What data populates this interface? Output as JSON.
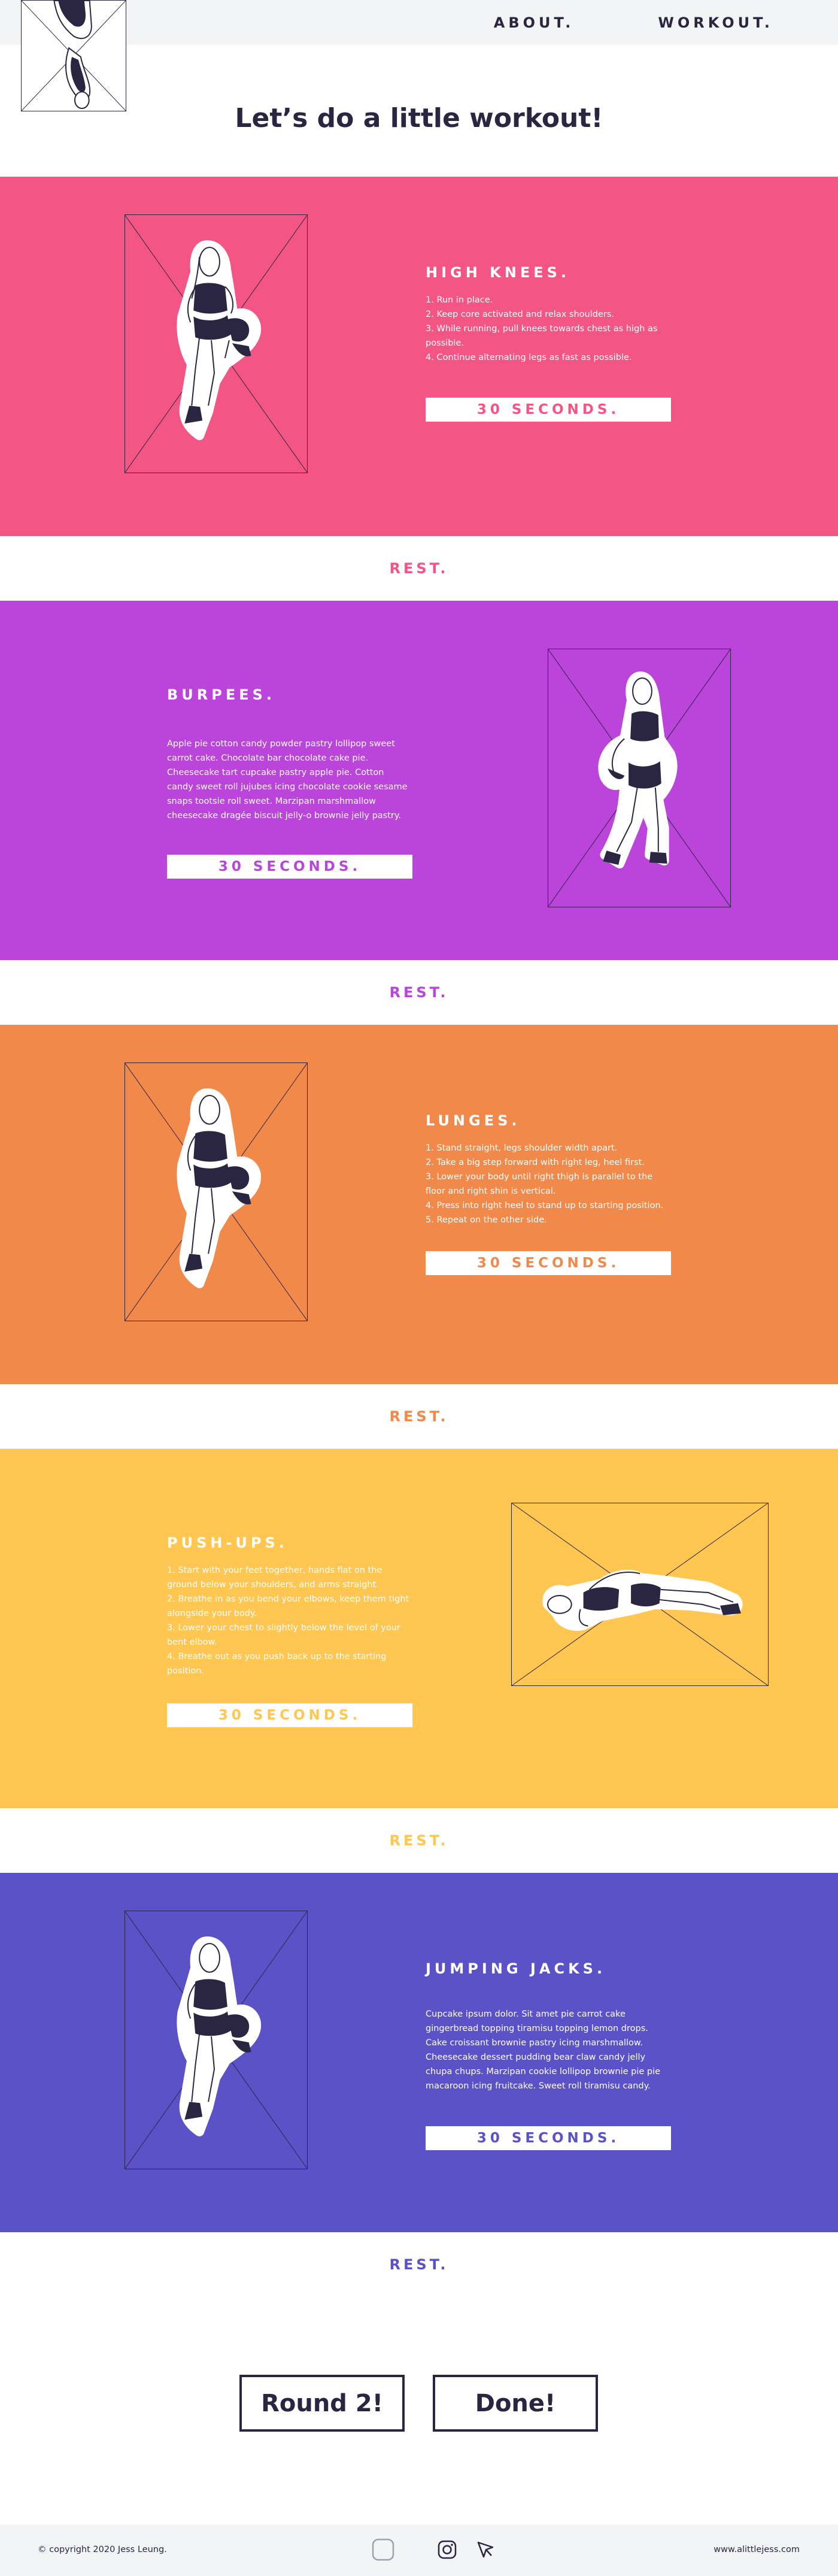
{
  "header": {
    "nav": [
      "ABOUT.",
      "WORKOUT."
    ]
  },
  "hero": {
    "title": "Let’s do a little workout!"
  },
  "exercises": [
    {
      "title": "HIGH KNEES.",
      "steps": [
        "1. Run in place.",
        "2. Keep core activated and relax shoulders.",
        "3. While running, pull knees towards chest as high as possible.",
        "4. Continue alternating legs as fast as possible."
      ],
      "duration": "30 SECONDS.",
      "accent": "#f35584"
    },
    {
      "title": "BURPEES.",
      "description": "Apple pie cotton candy powder pastry lollipop sweet carrot cake. Chocolate bar chocolate cake pie. Cheesecake tart cupcake pastry apple pie. Cotton candy sweet roll jujubes icing chocolate cookie sesame snaps tootsie roll sweet. Marzipan marshmallow cheesecake dragée biscuit jelly-o brownie jelly pastry.",
      "duration": "30 SECONDS.",
      "accent": "#bb44db"
    },
    {
      "title": "LUNGES.",
      "steps": [
        "1. Stand straight, legs shoulder width apart.",
        "2. Take a big step forward with right leg, heel first.",
        "3. Lower your body until right thigh is parallel to the floor and right shin is vertical.",
        "4. Press into right heel to stand up to starting position.",
        "5. Repeat on the other side."
      ],
      "duration": "30 SECONDS.",
      "accent": "#f1894a"
    },
    {
      "title": "PUSH-UPS.",
      "steps": [
        "1. Start with your feet together, hands flat on the ground below your shoulders, and arms straight.",
        "2. Breathe in as you bend your elbows, keep them tight alongside your body.",
        "3. Lower your chest to slightly below the level of your bent elbow.",
        "4. Breathe out as you push back up to the starting position."
      ],
      "duration": "30 SECONDS.",
      "accent": "#ffc651"
    },
    {
      "title": "JUMPING JACKS.",
      "description": "Cupcake ipsum dolor. Sit amet pie carrot cake gingerbread topping tiramisu topping lemon drops. Cake croissant brownie pastry icing marshmallow. Cheesecake dessert pudding bear claw candy jelly chupa chups. Marzipan cookie lollipop brownie pie pie macaroon icing fruitcake. Sweet roll tiramisu candy.",
      "duration": "30 SECONDS.",
      "accent": "#5b52c8"
    }
  ],
  "rest_label": "REST.",
  "actions": {
    "round2": "Round 2!",
    "done": "Done!"
  },
  "footer": {
    "copyright": "© copyright 2020 Jess Leung.",
    "site": "www.alittlejess.com",
    "icons": [
      "rounded-square-icon",
      "instagram-icon",
      "cursor-icon"
    ]
  },
  "colors": {
    "pink": "#f35584",
    "purple": "#bb44db",
    "orange": "#f1894a",
    "yellow": "#ffc651",
    "indigo": "#5b52c8",
    "ink": "#2a2540"
  }
}
